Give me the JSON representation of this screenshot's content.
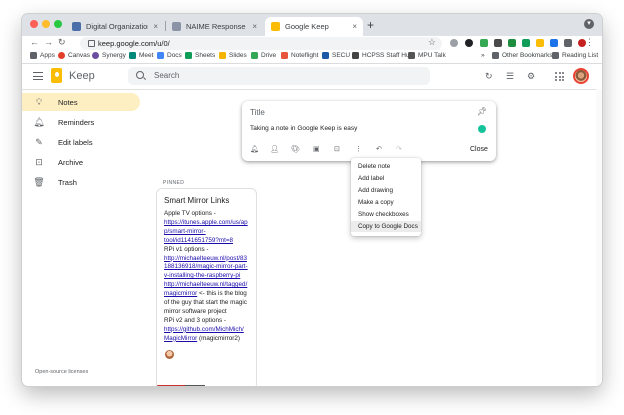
{
  "browser": {
    "tabs": [
      {
        "label": "Digital Organization Tools for",
        "favicon_color": "#4a6ea9",
        "active": false
      },
      {
        "label": "NAIME Response to New CDC",
        "favicon_color": "#8a94a6",
        "active": false
      },
      {
        "label": "Google Keep",
        "favicon_color": "#fbbc04",
        "active": true
      }
    ],
    "close_glyph": "×",
    "new_tab_glyph": "+",
    "url": "keep.google.com/u/0/",
    "bookmarks": [
      {
        "label": "Apps",
        "color": "#5f6368"
      },
      {
        "label": "Canvas",
        "color": "#e13f2b"
      },
      {
        "label": "Synergy",
        "color": "#6b4ea0"
      },
      {
        "label": "Meet",
        "color": "#00897b"
      },
      {
        "label": "Docs",
        "color": "#4285f4"
      },
      {
        "label": "Sheets",
        "color": "#0f9d58"
      },
      {
        "label": "Slides",
        "color": "#f4b400"
      },
      {
        "label": "Drive",
        "color": "#34a853"
      },
      {
        "label": "Noteflight",
        "color": "#e8553d"
      },
      {
        "label": "SECU",
        "color": "#1a5aa6"
      },
      {
        "label": "HCPSS Staff Hub",
        "color": "#444444"
      },
      {
        "label": "MPU Talk",
        "color": "#555555"
      }
    ],
    "other_bookmarks": "Other Bookmarks",
    "reading_list": "Reading List"
  },
  "keep": {
    "app_name": "Keep",
    "search_placeholder": "Search",
    "sidebar": [
      {
        "label": "Notes",
        "icon": "lightbulb-icon",
        "active": true
      },
      {
        "label": "Reminders",
        "icon": "bell-icon",
        "active": false
      },
      {
        "label": "Edit labels",
        "icon": "pencil-icon",
        "active": false
      },
      {
        "label": "Archive",
        "icon": "archive-icon",
        "active": false
      },
      {
        "label": "Trash",
        "icon": "trash-icon",
        "active": false
      }
    ],
    "open_source": "Open-source licenses",
    "composer": {
      "title_placeholder": "Title",
      "body": "Taking a note in Google Keep is easy",
      "close_label": "Close"
    },
    "menu": [
      "Delete note",
      "Add label",
      "Add drawing",
      "Make a copy",
      "Show checkboxes",
      "Copy to Google Docs"
    ],
    "menu_highlighted_index": 5,
    "pinned_label": "PINNED",
    "note": {
      "title": "Smart Mirror Links",
      "lines": [
        {
          "text": "Apple TV options -",
          "type": "txt"
        },
        {
          "text": "https://itunes.apple.com/us/ap",
          "type": "lnk"
        },
        {
          "text": "p/smart-mirror-",
          "type": "lnk"
        },
        {
          "text": "tool/id1141651759?mt=8",
          "type": "lnk"
        },
        {
          "text": "RPi v1 options -",
          "type": "txt"
        },
        {
          "text": "http://michaelteeuw.nl/post/83",
          "type": "lnk"
        },
        {
          "text": "188136918/magic-mirror-part-",
          "type": "lnk"
        },
        {
          "text": "v-installing-the-raspberry-pi",
          "type": "lnk"
        },
        {
          "text": "http://michaelteeuw.nl/tagged/",
          "type": "lnk"
        },
        {
          "text": "magicmirror",
          "type": "mix",
          "suffix": " <- this is the blog"
        },
        {
          "text": "of the guy that start the magic",
          "type": "txt"
        },
        {
          "text": "mirror software project",
          "type": "txt"
        },
        {
          "text": "RPi v2 and 3 options -",
          "type": "txt"
        },
        {
          "text": "https://github.com/MichMich/",
          "type": "lnk"
        },
        {
          "text": "MagicMirror",
          "type": "mix",
          "suffix": " (magicmirror2)"
        }
      ]
    }
  }
}
